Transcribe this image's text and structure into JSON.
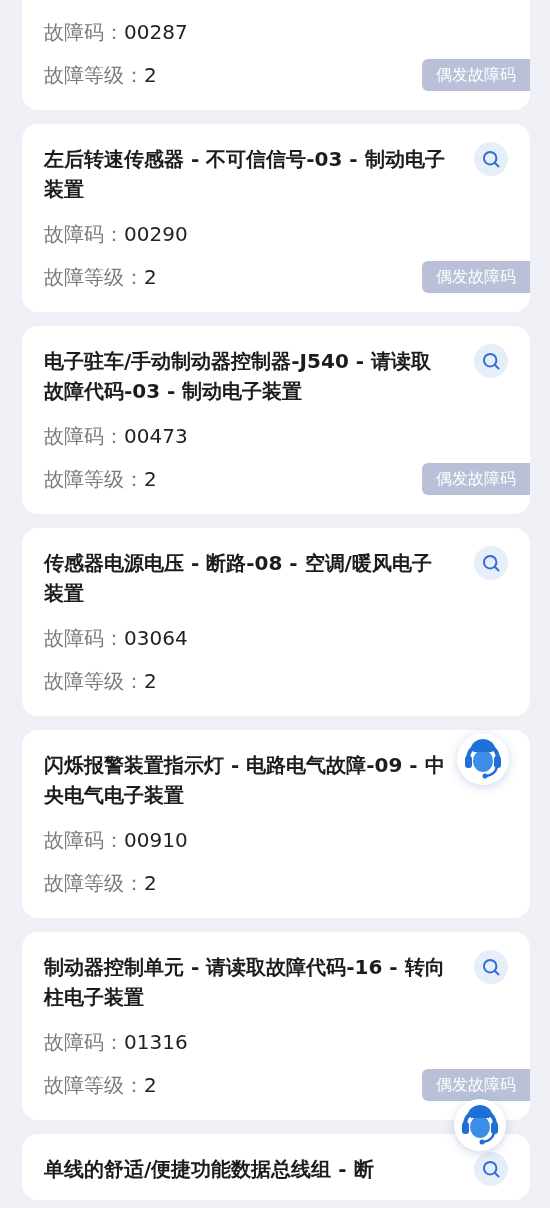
{
  "fault_list": [
    {
      "code_label": "故障码：",
      "code": "00287",
      "level_label": "故障等级：",
      "level": "2",
      "badge": "偶发故障码"
    },
    {
      "title": "左后转速传感器 - 不可信信号-03 - 制动电子装置",
      "code_label": "故障码：",
      "code": "00290",
      "level_label": "故障等级：",
      "level": "2",
      "badge": "偶发故障码",
      "search_button": true
    },
    {
      "title": "电子驻车/手动制动器控制器-J540 - 请读取故障代码-03 - 制动电子装置",
      "code_label": "故障码：",
      "code": "00473",
      "level_label": "故障等级：",
      "level": "2",
      "badge": "偶发故障码",
      "search_button": true
    },
    {
      "title": "传感器电源电压 - 断路-08 - 空调/暖风电子装置",
      "code_label": "故障码：",
      "code": "03064",
      "level_label": "故障等级：",
      "level": "2",
      "search_button": true
    },
    {
      "title": "闪烁报警装置指示灯 - 电路电气故障-09 - 中央电气电子装置",
      "code_label": "故障码：",
      "code": "00910",
      "level_label": "故障等级：",
      "level": "2",
      "search_button": false
    },
    {
      "title": "制动器控制单元 - 请读取故障代码-16 - 转向柱电子装置",
      "code_label": "故障码：",
      "code": "01316",
      "level_label": "故障等级：",
      "level": "2",
      "badge": "偶发故障码",
      "search_button": true
    },
    {
      "title": "单线的舒适/便捷功能数据总线组 - 断",
      "search_button": true
    }
  ]
}
